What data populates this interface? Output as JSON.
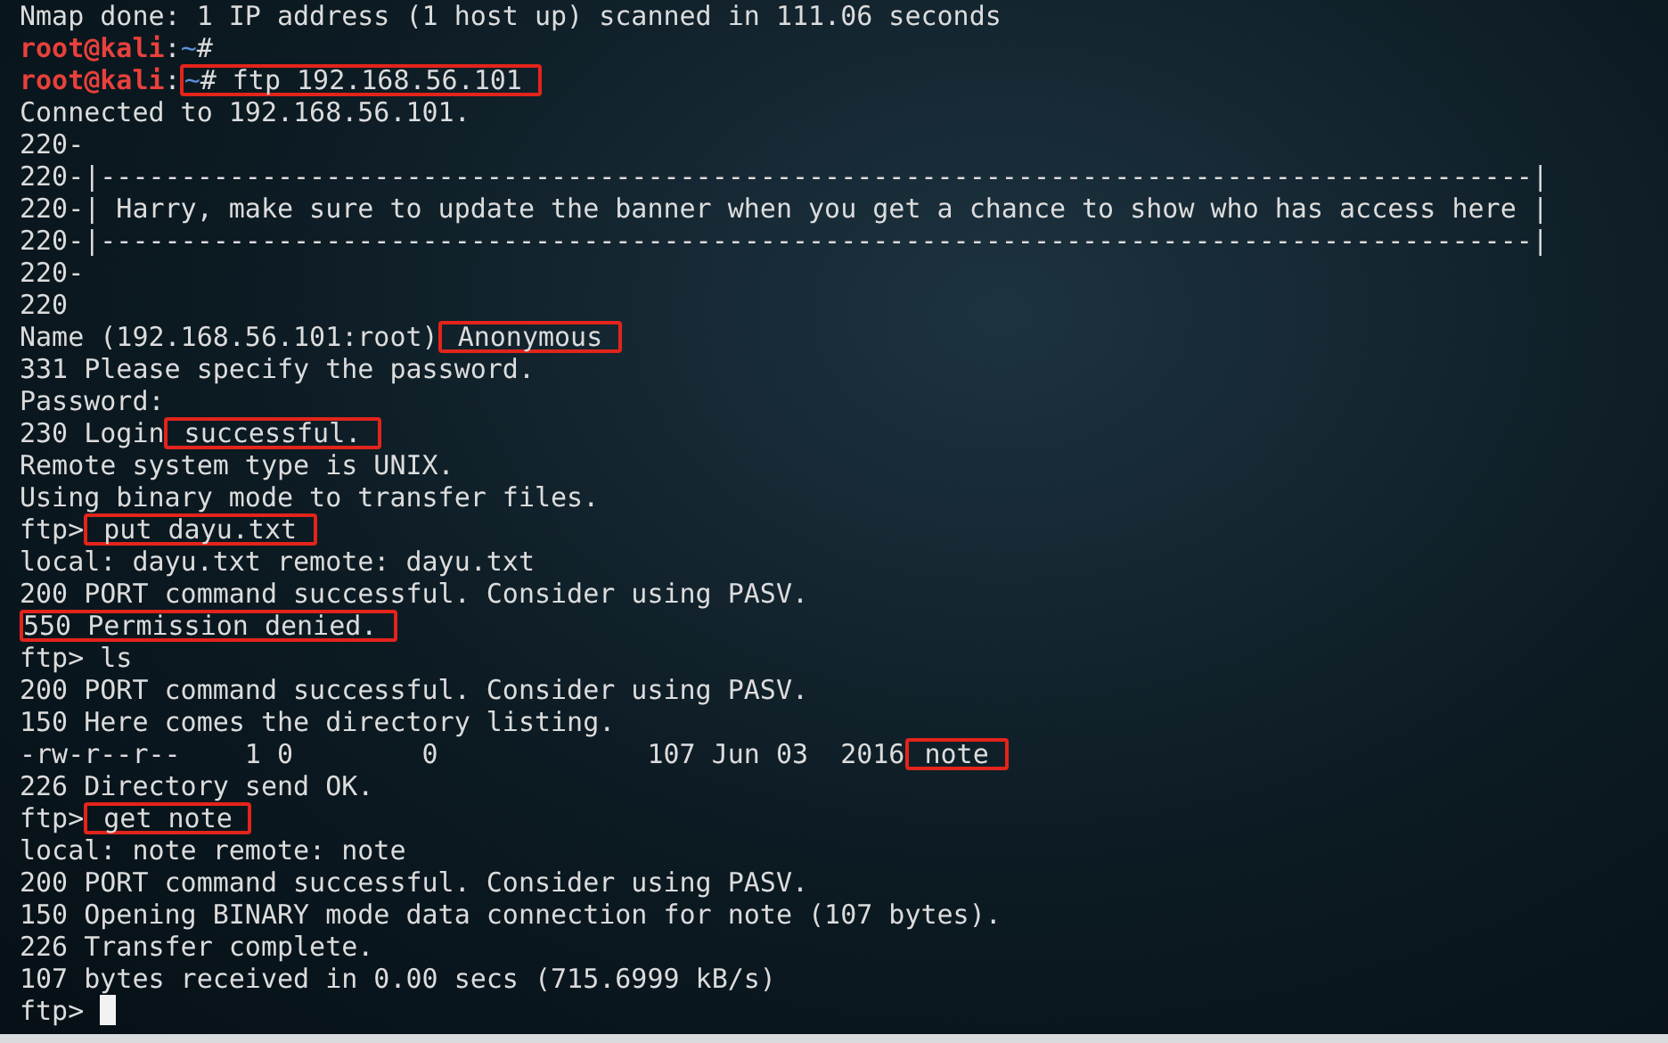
{
  "terminal": {
    "lines": [
      {
        "segments": [
          {
            "text": "Nmap done: 1 IP address (1 host up) scanned in 111.06 seconds",
            "kind": "text",
            "boxed": false
          }
        ]
      },
      {
        "segments": [
          {
            "text": "root@kali",
            "kind": "user",
            "boxed": false
          },
          {
            "text": ":",
            "kind": "text",
            "boxed": false
          },
          {
            "text": "~",
            "kind": "path",
            "boxed": false
          },
          {
            "text": "#",
            "kind": "text",
            "boxed": false
          }
        ]
      },
      {
        "segments": [
          {
            "text": "root@kali",
            "kind": "user",
            "boxed": false
          },
          {
            "text": ":",
            "kind": "text",
            "boxed": false
          },
          {
            "text": "~",
            "kind": "path",
            "boxed": true
          },
          {
            "text": "# ftp 192.168.56.101 ",
            "kind": "text",
            "boxed": true
          }
        ]
      },
      {
        "segments": [
          {
            "text": "Connected to 192.168.56.101.",
            "kind": "text",
            "boxed": false
          }
        ]
      },
      {
        "segments": [
          {
            "text": "220-",
            "kind": "text",
            "boxed": false
          }
        ]
      },
      {
        "segments": [
          {
            "text": "220-|-----------------------------------------------------------------------------------------|",
            "kind": "text",
            "boxed": false
          }
        ]
      },
      {
        "segments": [
          {
            "text": "220-| Harry, make sure to update the banner when you get a chance to show who has access here |",
            "kind": "text",
            "boxed": false
          }
        ]
      },
      {
        "segments": [
          {
            "text": "220-|-----------------------------------------------------------------------------------------|",
            "kind": "text",
            "boxed": false
          }
        ]
      },
      {
        "segments": [
          {
            "text": "220-",
            "kind": "text",
            "boxed": false
          }
        ]
      },
      {
        "segments": [
          {
            "text": "220",
            "kind": "text",
            "boxed": false
          }
        ]
      },
      {
        "segments": [
          {
            "text": "Name (192.168.56.101:root)",
            "kind": "text",
            "boxed": false
          },
          {
            "text": " Anonymous ",
            "kind": "text",
            "boxed": true
          }
        ]
      },
      {
        "segments": [
          {
            "text": "331 Please specify the password.",
            "kind": "text",
            "boxed": false
          }
        ]
      },
      {
        "segments": [
          {
            "text": "Password:",
            "kind": "text",
            "boxed": false
          }
        ]
      },
      {
        "segments": [
          {
            "text": "230 Login",
            "kind": "text",
            "boxed": false
          },
          {
            "text": " successful. ",
            "kind": "text",
            "boxed": true
          }
        ]
      },
      {
        "segments": [
          {
            "text": "Remote system type is UNIX.",
            "kind": "text",
            "boxed": false
          }
        ]
      },
      {
        "segments": [
          {
            "text": "Using binary mode to transfer files.",
            "kind": "text",
            "boxed": false
          }
        ]
      },
      {
        "segments": [
          {
            "text": "ftp>",
            "kind": "text",
            "boxed": false
          },
          {
            "text": " put dayu.txt ",
            "kind": "text",
            "boxed": true
          }
        ]
      },
      {
        "segments": [
          {
            "text": "local: dayu.txt remote: dayu.txt",
            "kind": "text",
            "boxed": false
          }
        ]
      },
      {
        "segments": [
          {
            "text": "200 PORT command successful. Consider using PASV.",
            "kind": "text",
            "boxed": false
          }
        ]
      },
      {
        "segments": [
          {
            "text": "550 Permission denied. ",
            "kind": "text",
            "boxed": true
          }
        ]
      },
      {
        "segments": [
          {
            "text": "ftp> ls",
            "kind": "text",
            "boxed": false
          }
        ]
      },
      {
        "segments": [
          {
            "text": "200 PORT command successful. Consider using PASV.",
            "kind": "text",
            "boxed": false
          }
        ]
      },
      {
        "segments": [
          {
            "text": "150 Here comes the directory listing.",
            "kind": "text",
            "boxed": false
          }
        ]
      },
      {
        "segments": [
          {
            "text": "-rw-r--r--    1 0        0             107 Jun 03  2016",
            "kind": "text",
            "boxed": false
          },
          {
            "text": " note ",
            "kind": "text",
            "boxed": true
          }
        ]
      },
      {
        "segments": [
          {
            "text": "226 Directory send OK.",
            "kind": "text",
            "boxed": false
          }
        ]
      },
      {
        "segments": [
          {
            "text": "ftp>",
            "kind": "text",
            "boxed": false
          },
          {
            "text": " get note ",
            "kind": "text",
            "boxed": true
          }
        ]
      },
      {
        "segments": [
          {
            "text": "local: note remote: note",
            "kind": "text",
            "boxed": false
          }
        ]
      },
      {
        "segments": [
          {
            "text": "200 PORT command successful. Consider using PASV.",
            "kind": "text",
            "boxed": false
          }
        ]
      },
      {
        "segments": [
          {
            "text": "150 Opening BINARY mode data connection for note (107 bytes).",
            "kind": "text",
            "boxed": false
          }
        ]
      },
      {
        "segments": [
          {
            "text": "226 Transfer complete.",
            "kind": "text",
            "boxed": false
          }
        ]
      },
      {
        "segments": [
          {
            "text": "107 bytes received in 0.00 secs (715.6999 kB/s)",
            "kind": "text",
            "boxed": false
          }
        ]
      },
      {
        "segments": [
          {
            "text": "ftp> ",
            "kind": "text",
            "boxed": false
          }
        ],
        "cursor": true
      }
    ]
  }
}
